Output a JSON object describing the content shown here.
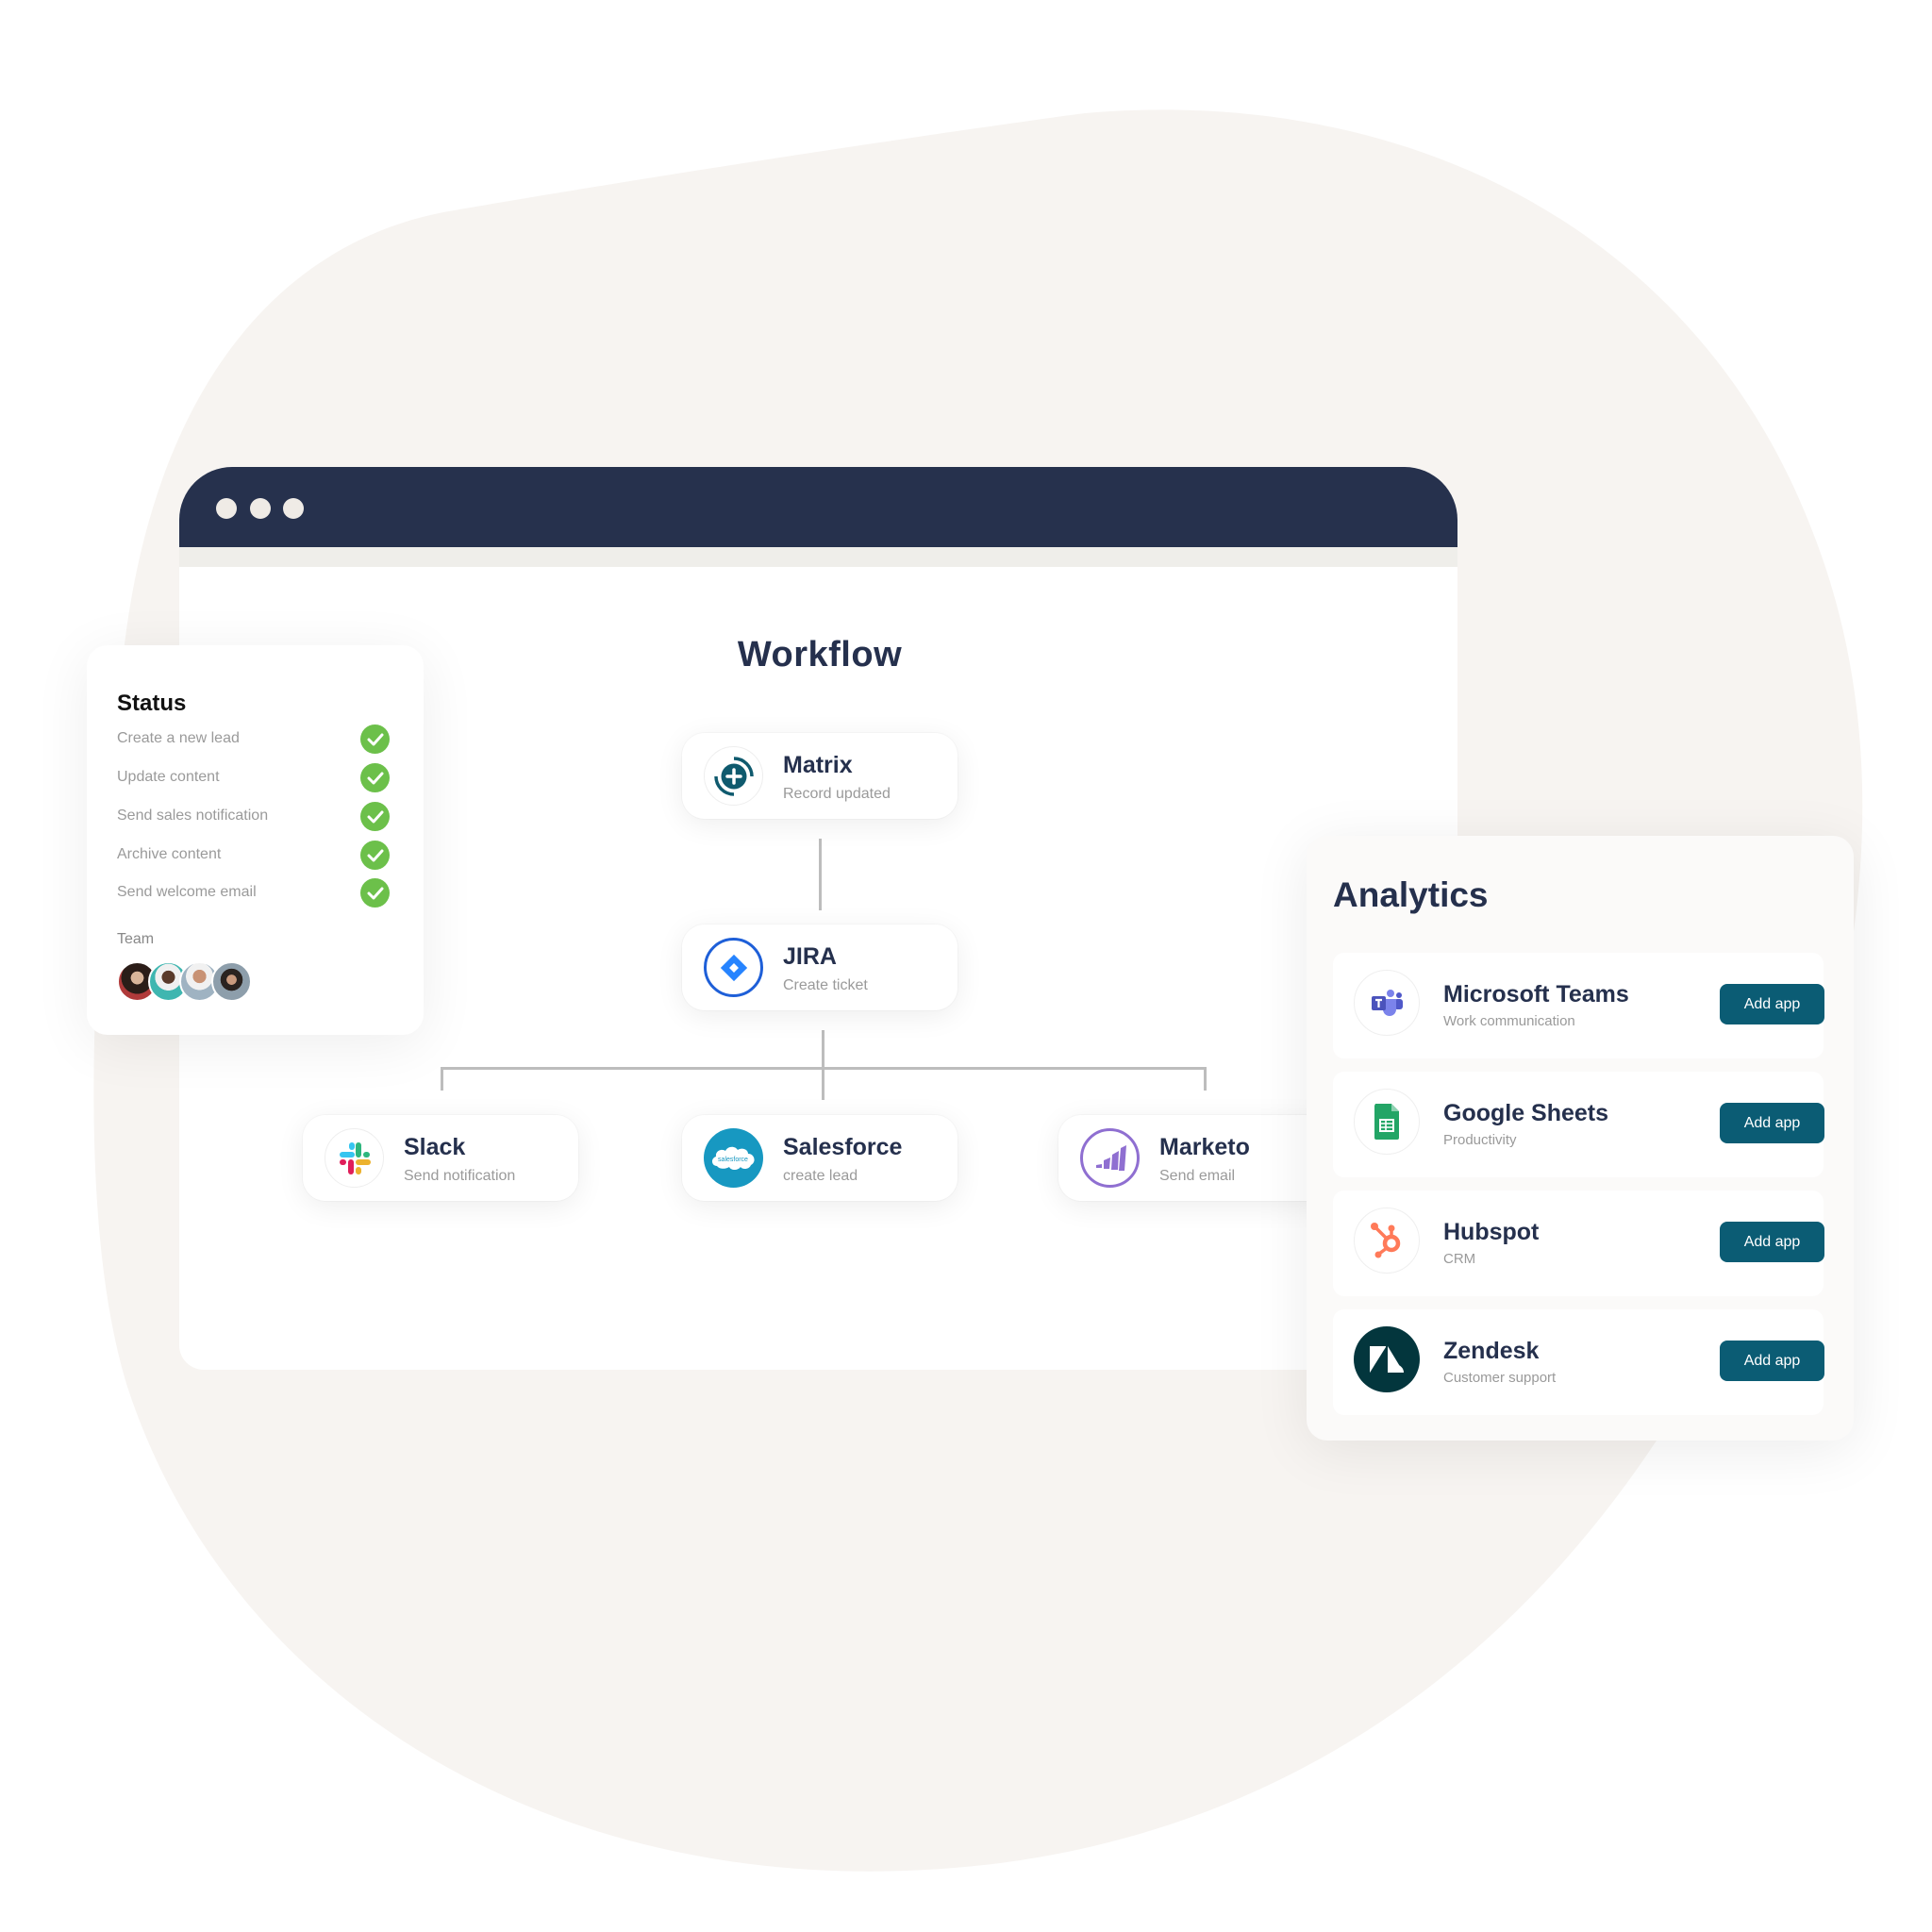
{
  "colors": {
    "blob": "#f7f4f1",
    "window_bar": "#26314d",
    "title_text": "#25304d",
    "check_green": "#6cc04a",
    "button_teal": "#0b5c74",
    "muted_text": "#9a9a9a"
  },
  "window": {
    "dots": [
      "window-dot",
      "window-dot",
      "window-dot"
    ]
  },
  "workflow": {
    "title": "Workflow",
    "nodes": [
      {
        "id": "matrix",
        "title": "Matrix",
        "subtitle": "Record updated",
        "icon": "matrix-plus-icon"
      },
      {
        "id": "jira",
        "title": "JIRA",
        "subtitle": "Create ticket",
        "icon": "jira-icon"
      },
      {
        "id": "slack",
        "title": "Slack",
        "subtitle": "Send notification",
        "icon": "slack-icon"
      },
      {
        "id": "salesforce",
        "title": "Salesforce",
        "subtitle": "create lead",
        "icon": "salesforce-icon",
        "icon_text": "salesforce"
      },
      {
        "id": "marketo",
        "title": "Marketo",
        "subtitle": "Send email",
        "icon": "marketo-icon"
      }
    ]
  },
  "status": {
    "title": "Status",
    "items": [
      {
        "label": "Create a new lead",
        "done": true
      },
      {
        "label": "Update content",
        "done": true
      },
      {
        "label": "Send sales notification",
        "done": true
      },
      {
        "label": "Archive content",
        "done": true
      },
      {
        "label": "Send welcome email",
        "done": true
      }
    ],
    "team_label": "Team",
    "team_avatars": 4
  },
  "analytics": {
    "title": "Analytics",
    "apps": [
      {
        "name": "Microsoft Teams",
        "category": "Work communication",
        "icon": "microsoft-teams-icon",
        "button": "Add app"
      },
      {
        "name": "Google Sheets",
        "category": "Productivity",
        "icon": "google-sheets-icon",
        "button": "Add app"
      },
      {
        "name": "Hubspot",
        "category": "CRM",
        "icon": "hubspot-icon",
        "button": "Add app"
      },
      {
        "name": "Zendesk",
        "category": "Customer support",
        "icon": "zendesk-icon",
        "button": "Add app"
      }
    ]
  }
}
